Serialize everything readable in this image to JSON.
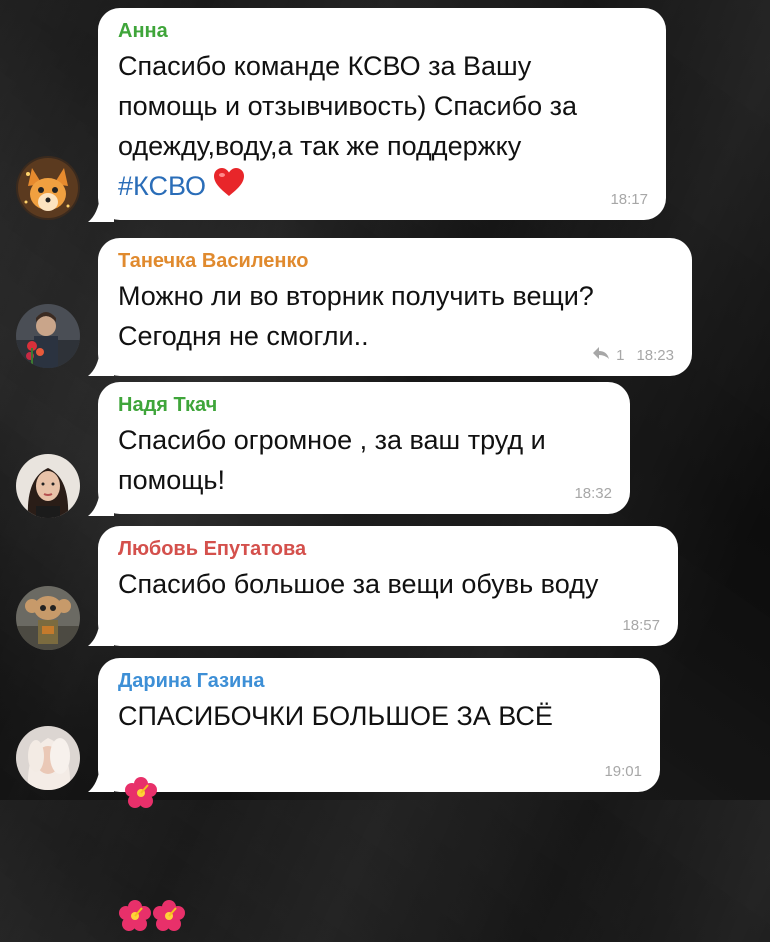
{
  "messages": [
    {
      "sender": "Анна",
      "sender_color": "#3fa53a",
      "text": "Спасибо команде КСВО за Вашу\nпомощь и отзывчивость) Спасибо за\nодежду,воду,а так же поддержку",
      "hashtag": "#КСВО",
      "time": "18:17"
    },
    {
      "sender": "Танечка Василенко",
      "sender_color": "#e08a2e",
      "text": "Можно ли во вторник  получить вещи?\nСегодня не смогли..",
      "reply_count": "1",
      "time": "18:23"
    },
    {
      "sender": "Надя Ткач",
      "sender_color": "#3fa53a",
      "text": "Спасибо огромное , за ваш труд и\nпомощь!",
      "time": "18:32"
    },
    {
      "sender": "Любовь Епутатова",
      "sender_color": "#d4504c",
      "text": "Спасибо большое за вещи обувь воду",
      "time": "18:57"
    },
    {
      "sender": "Дарина Газина",
      "sender_color": "#3d8fd6",
      "text": "СПАСИБОЧКИ БОЛЬШОЕ ЗА ВСЁ",
      "time": "19:01"
    }
  ],
  "icons": {
    "heart": "red-heart-icon",
    "flower": "hibiscus-icon",
    "reply": "reply-arrow-icon"
  }
}
